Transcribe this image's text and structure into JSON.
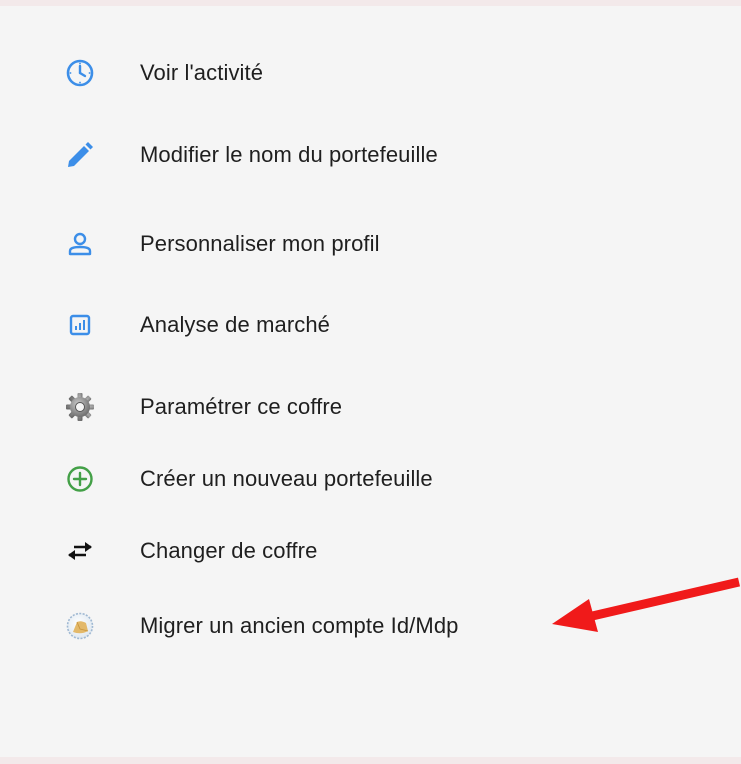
{
  "menu": {
    "items": [
      {
        "label": "Voir l'activité",
        "icon": "clock-icon"
      },
      {
        "label": "Modifier le nom du portefeuille",
        "icon": "pencil-icon"
      },
      {
        "label": "Personnaliser mon profil",
        "icon": "user-icon"
      },
      {
        "label": "Analyse de marché",
        "icon": "chart-icon"
      },
      {
        "label": "Paramétrer ce coffre",
        "icon": "gear-icon"
      },
      {
        "label": "Créer un nouveau portefeuille",
        "icon": "add-circle-icon"
      },
      {
        "label": "Changer de coffre",
        "icon": "swap-arrows-icon"
      },
      {
        "label": "Migrer un ancien compte Id/Mdp",
        "icon": "migrate-account-icon"
      }
    ]
  },
  "colors": {
    "background": "#f5f5f5",
    "icon_blue": "#3c8ee8",
    "icon_green": "#43a047",
    "text": "#1f1f1f",
    "annotation_arrow": "#f01a1a"
  }
}
